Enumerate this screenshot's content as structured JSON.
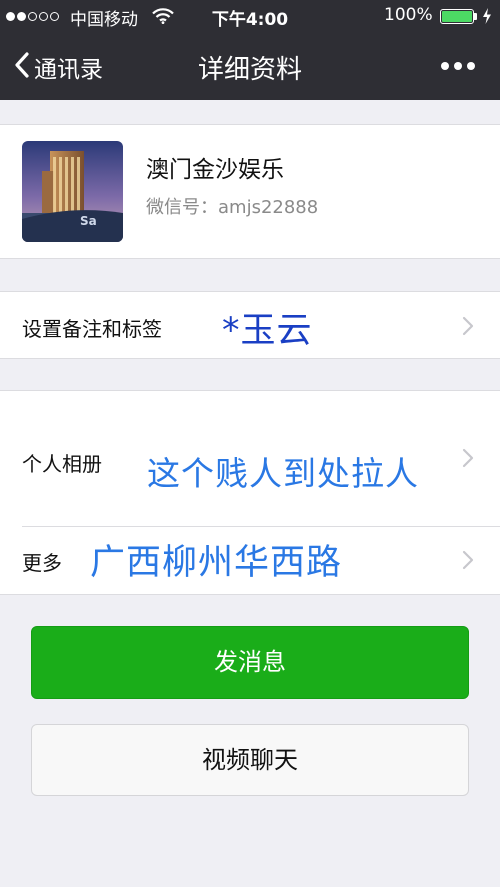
{
  "status_bar": {
    "carrier": "中国移动",
    "time": "下午4:00",
    "battery_percent": "100%",
    "signal_strength_of_5": 2,
    "battery_level": 1.0,
    "icons": [
      "signal-dots-icon",
      "wifi-icon",
      "battery-icon",
      "charging-bolt-icon"
    ]
  },
  "nav": {
    "back_label": "通讯录",
    "title": "详细资料",
    "more_icon": "more-dots-icon"
  },
  "profile": {
    "name": "澳门金沙娱乐",
    "wechat_id": "微信号：amjs22888"
  },
  "remark_row": {
    "label": "设置备注和标签",
    "handwritten": "*玉云"
  },
  "album_row": {
    "label": "个人相册",
    "handwritten": "这个贱人到处拉人"
  },
  "more_row": {
    "label": "更多",
    "handwritten": "广西柳州华西路"
  },
  "buttons": {
    "send_message": "发消息",
    "video_chat": "视频聊天"
  },
  "colors": {
    "nav_background": "#2e2e34",
    "page_background": "#efeff4",
    "primary_green": "#1aad19",
    "handwriting_blue_dark": "#1a3fc4",
    "handwriting_blue_light": "#2a78e4"
  }
}
